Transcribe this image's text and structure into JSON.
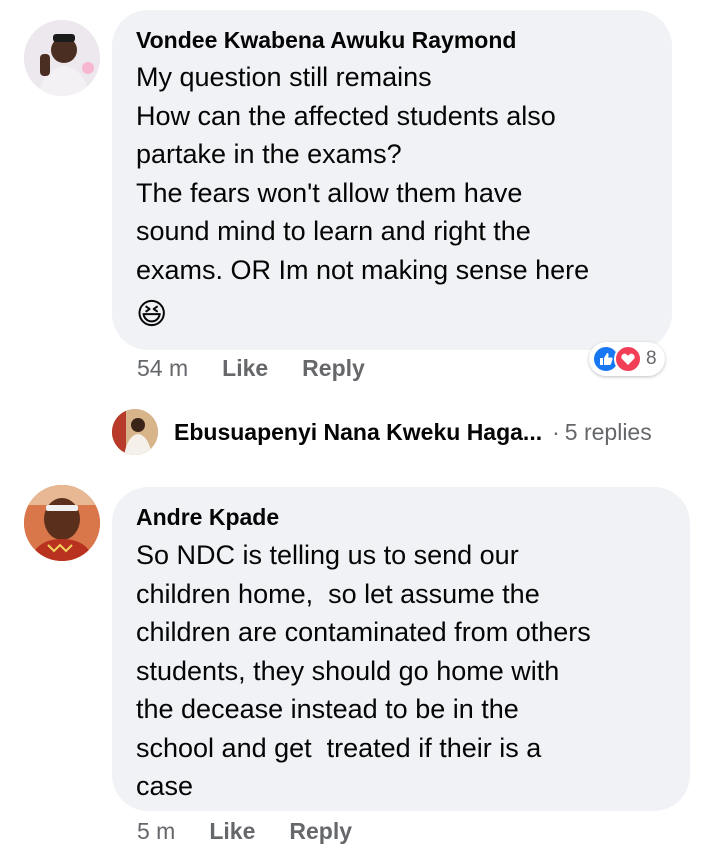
{
  "comments": [
    {
      "author": "Vondee Kwabena Awuku Raymond",
      "lines": [
        "My question still remains",
        "How can the affected students also",
        "partake in the exams?",
        "The fears won't allow them have",
        "sound mind to learn and right the",
        "exams. OR Im not making sense here"
      ],
      "emoji": "😆",
      "time": "54 m",
      "like_label": "Like",
      "reply_label": "Reply",
      "reaction_count": "8",
      "reaction_icons": [
        "like-reaction-icon",
        "love-reaction-icon"
      ]
    },
    {
      "author": "Andre Kpade",
      "lines": [
        "So NDC is telling us to send our",
        "children home,  so let assume the",
        "children are contaminated from others",
        "students, they should go home with",
        "the decease instead to be in the",
        "school and get  treated if their is a",
        "case"
      ],
      "time": "5 m",
      "like_label": "Like",
      "reply_label": "Reply"
    }
  ],
  "reply_preview": {
    "author": "Ebusuapenyi Nana Kweku Haga...",
    "separator": "·",
    "count_text": "5 replies"
  },
  "colors": {
    "bubble": "#f0f2f5",
    "meta": "#65676b",
    "like_blue": "#1877f2",
    "love_red": "#f33e58"
  }
}
